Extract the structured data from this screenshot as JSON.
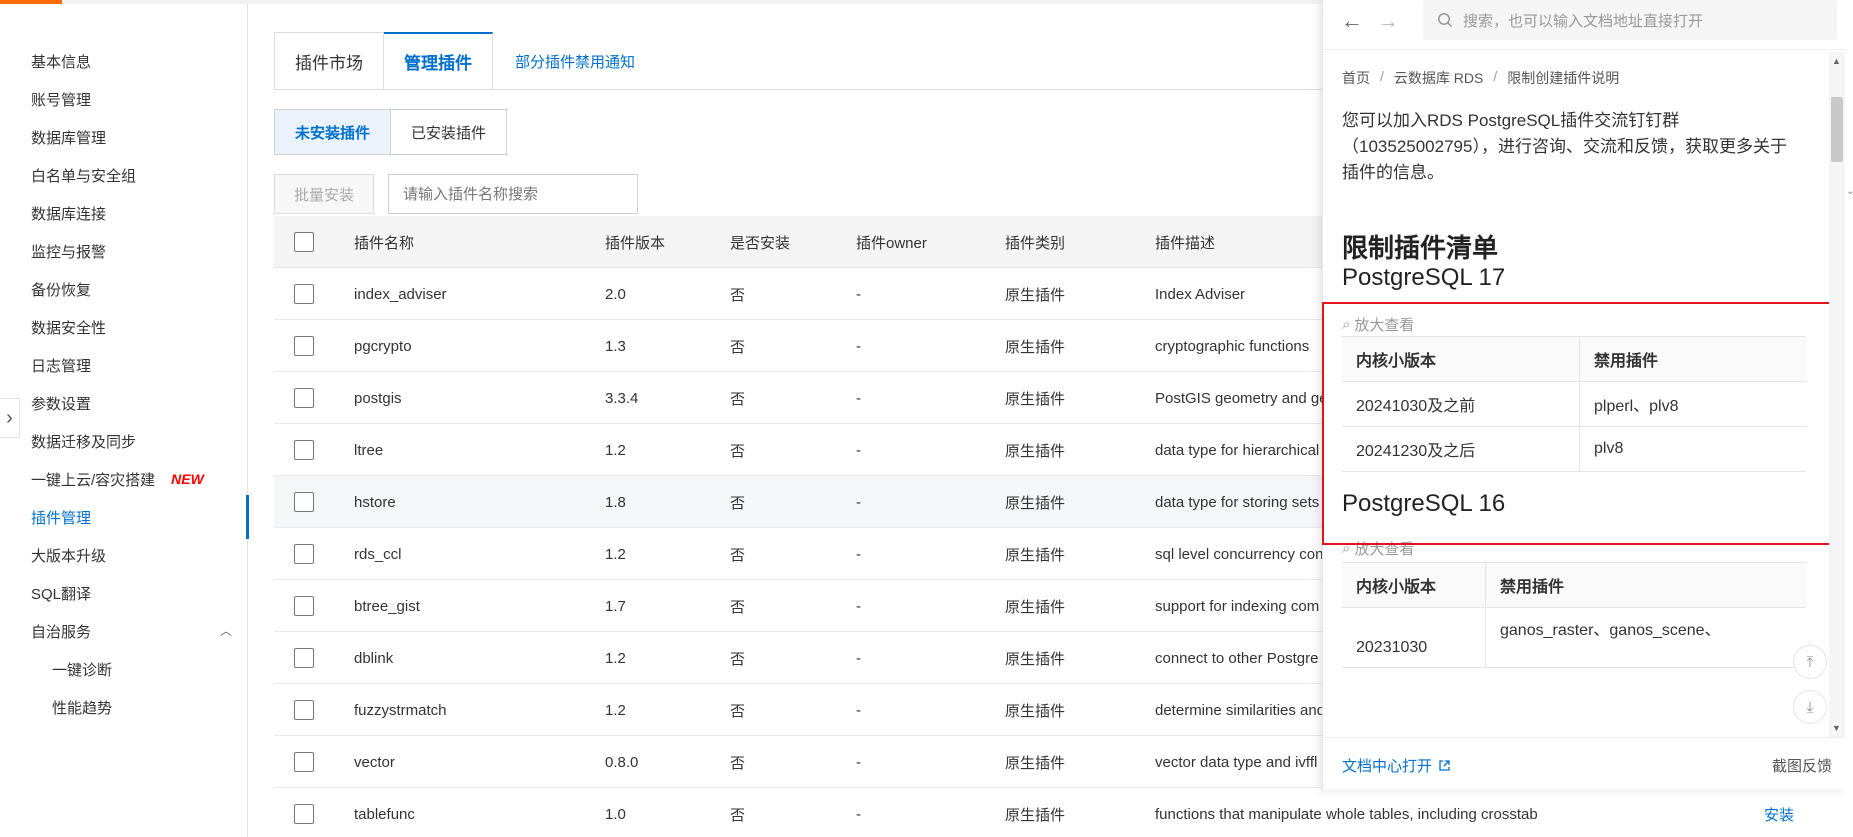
{
  "sidebar": {
    "items": [
      {
        "label": "基本信息"
      },
      {
        "label": "账号管理"
      },
      {
        "label": "数据库管理"
      },
      {
        "label": "白名单与安全组"
      },
      {
        "label": "数据库连接"
      },
      {
        "label": "监控与报警"
      },
      {
        "label": "备份恢复"
      },
      {
        "label": "数据安全性"
      },
      {
        "label": "日志管理"
      },
      {
        "label": "参数设置"
      },
      {
        "label": "数据迁移及同步"
      },
      {
        "label": "一键上云/容灾搭建",
        "badge": "NEW"
      },
      {
        "label": "插件管理",
        "active": true
      },
      {
        "label": "大版本升级"
      },
      {
        "label": "SQL翻译"
      },
      {
        "label": "自治服务",
        "expanded": true
      },
      {
        "label": "一键诊断",
        "sub": true
      },
      {
        "label": "性能趋势",
        "sub": true
      }
    ]
  },
  "tabs": {
    "market": "插件市场",
    "manage": "管理插件",
    "notice_link": "部分插件禁用通知"
  },
  "segment": {
    "not_installed": "未安装插件",
    "installed": "已安装插件"
  },
  "toolbar": {
    "batch_install": "批量安装",
    "search_placeholder": "请输入插件名称搜索"
  },
  "table": {
    "headers": {
      "name": "插件名称",
      "version": "插件版本",
      "installed": "是否安装",
      "owner": "插件owner",
      "type": "插件类别",
      "desc": "插件描述"
    },
    "rows": [
      {
        "name": "index_adviser",
        "version": "2.0",
        "installed": "否",
        "owner": "-",
        "type": "原生插件",
        "desc": "Index Adviser"
      },
      {
        "name": "pgcrypto",
        "version": "1.3",
        "installed": "否",
        "owner": "-",
        "type": "原生插件",
        "desc": "cryptographic functions"
      },
      {
        "name": "postgis",
        "version": "3.3.4",
        "installed": "否",
        "owner": "-",
        "type": "原生插件",
        "desc": "PostGIS geometry and ge"
      },
      {
        "name": "ltree",
        "version": "1.2",
        "installed": "否",
        "owner": "-",
        "type": "原生插件",
        "desc": "data type for hierarchical"
      },
      {
        "name": "hstore",
        "version": "1.8",
        "installed": "否",
        "owner": "-",
        "type": "原生插件",
        "desc": "data type for storing sets"
      },
      {
        "name": "rds_ccl",
        "version": "1.2",
        "installed": "否",
        "owner": "-",
        "type": "原生插件",
        "desc": "sql level concurrency con"
      },
      {
        "name": "btree_gist",
        "version": "1.7",
        "installed": "否",
        "owner": "-",
        "type": "原生插件",
        "desc": "support for indexing com"
      },
      {
        "name": "dblink",
        "version": "1.2",
        "installed": "否",
        "owner": "-",
        "type": "原生插件",
        "desc": "connect to other Postgre"
      },
      {
        "name": "fuzzystrmatch",
        "version": "1.2",
        "installed": "否",
        "owner": "-",
        "type": "原生插件",
        "desc": "determine similarities and"
      },
      {
        "name": "vector",
        "version": "0.8.0",
        "installed": "否",
        "owner": "-",
        "type": "原生插件",
        "desc": "vector data type and ivffl"
      },
      {
        "name": "tablefunc",
        "version": "1.0",
        "installed": "否",
        "owner": "-",
        "type": "原生插件",
        "desc": "functions that manipulate whole tables, including crosstab",
        "action": "安装"
      }
    ]
  },
  "doc": {
    "search_placeholder": "搜索，也可以输入文档地址直接打开",
    "breadcrumb": [
      "首页",
      "云数据库 RDS",
      "限制创建插件说明"
    ],
    "intro": "您可以加入RDS PostgreSQL插件交流钉钉群（103525002795），进行咨询、交流和反馈，获取更多关于插件的信息。",
    "list_heading": "限制插件清单",
    "zoom_label": "放大查看",
    "col_kernel": "内核小版本",
    "col_disabled": "禁用插件",
    "pg17": {
      "title": "PostgreSQL 17",
      "rows": [
        {
          "kernel": "20241030及之前",
          "disabled": "plperl、plv8"
        },
        {
          "kernel": "20241230及之后",
          "disabled": "plv8"
        }
      ]
    },
    "pg16": {
      "title": "PostgreSQL 16",
      "rows": [
        {
          "kernel": "20231030",
          "disabled": "ganos_raster、ganos_scene、"
        }
      ]
    },
    "footer_link": "文档中心打开",
    "footer_feedback": "截图反馈"
  }
}
